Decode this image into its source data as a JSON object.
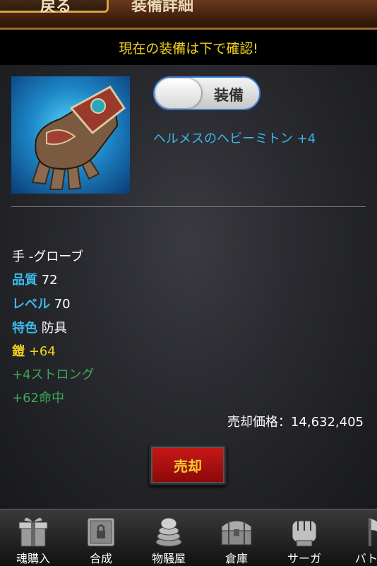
{
  "header": {
    "back_label": "戻る",
    "title": "装備詳細"
  },
  "notice": "現在の装備は下で確認!",
  "item": {
    "toggle_label": "装備",
    "name": "ヘルメスのヘビーミトン +4",
    "slot": "手 -グローブ",
    "stats": [
      {
        "label": "品質",
        "value": "72"
      },
      {
        "label": "レベル",
        "value": "70"
      },
      {
        "label": "特色",
        "value": "防具"
      }
    ],
    "armor": {
      "label": "鎧",
      "value": "+64"
    },
    "bonuses": [
      "+4ストロング",
      "+62命中"
    ],
    "sell_price": "売却価格：14,632,405",
    "sell_button": "売却"
  },
  "tabs": [
    {
      "label": "魂購入",
      "icon": "gift-box-icon"
    },
    {
      "label": "合成",
      "icon": "safe-lock-icon"
    },
    {
      "label": "物騒屋",
      "icon": "coin-stack-icon"
    },
    {
      "label": "倉庫",
      "icon": "treasure-chest-icon"
    },
    {
      "label": "サーガ",
      "icon": "fist-icon"
    },
    {
      "label": "バトル",
      "icon": "axe-icon"
    }
  ]
}
